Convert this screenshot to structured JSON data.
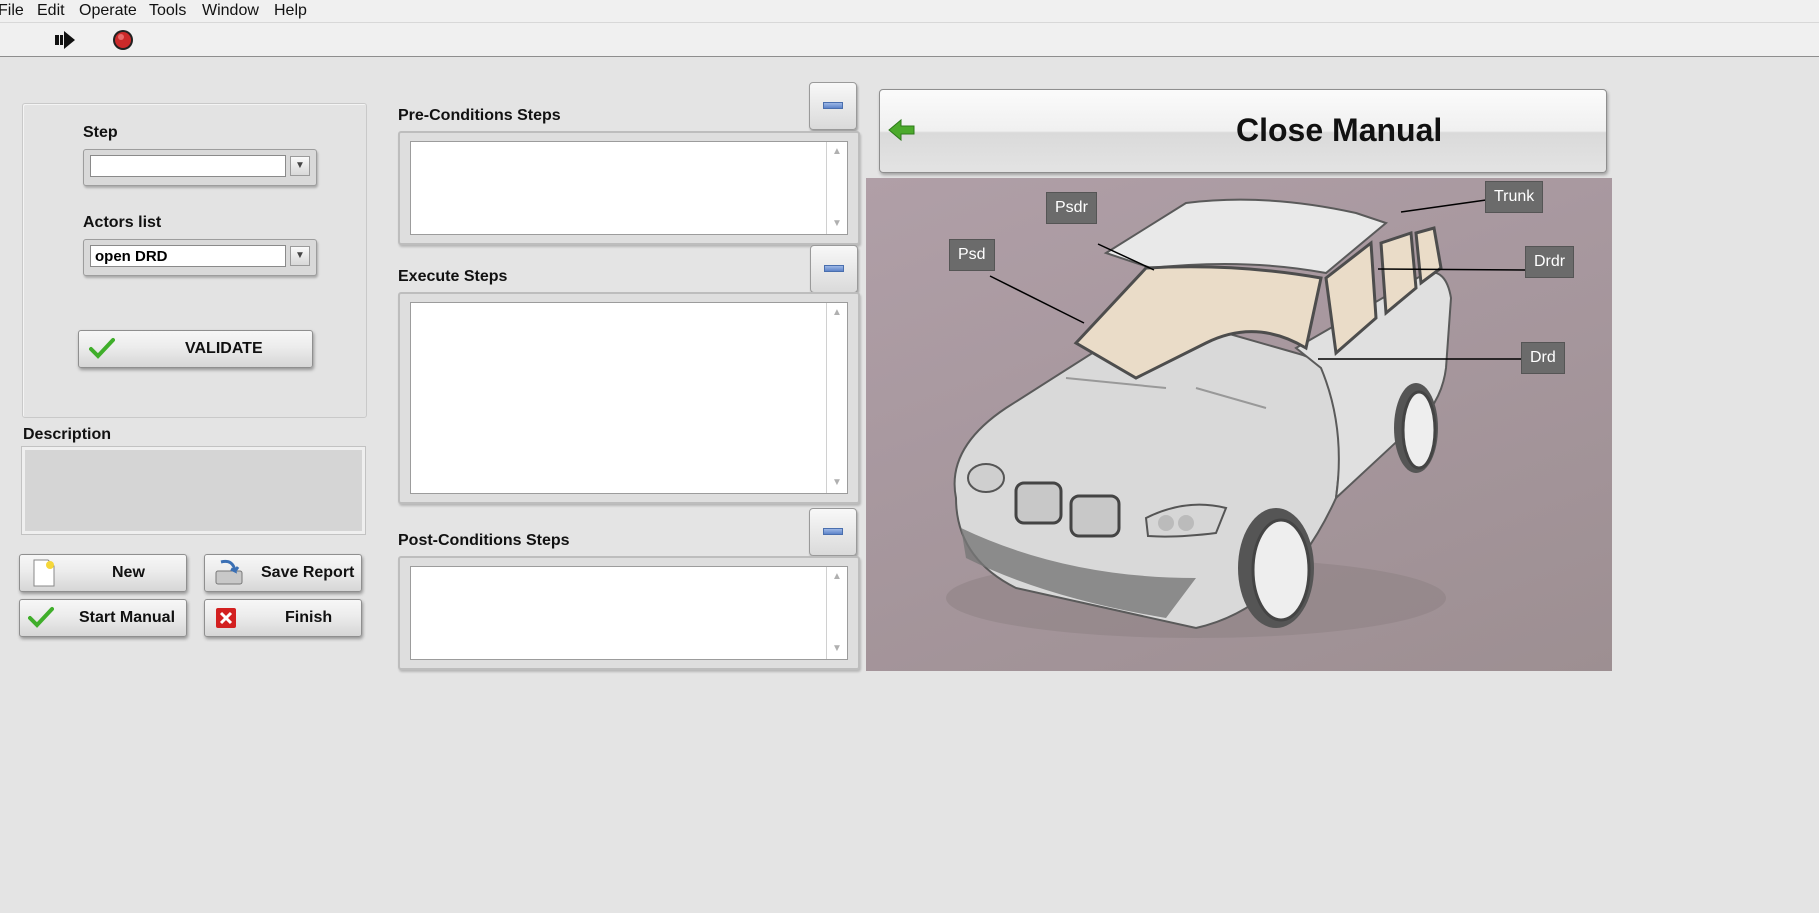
{
  "menu": {
    "items": [
      "File",
      "Edit",
      "Operate",
      "Tools",
      "Window",
      "Help"
    ]
  },
  "toolbar": {
    "run_icon": "run-arrow-icon",
    "stop_icon": "stop-icon"
  },
  "form": {
    "step_label": "Step",
    "step_value": "",
    "actors_label": "Actors list",
    "actors_value": "open DRD",
    "validate_label": "VALIDATE",
    "description_label": "Description",
    "description_value": ""
  },
  "buttons": {
    "new_label": "New",
    "save_report_label": "Save Report",
    "start_manual_label": "Start Manual",
    "finish_label": "Finish"
  },
  "steps": {
    "pre_label": "Pre-Conditions Steps",
    "pre_value": "",
    "execute_label": "Execute Steps",
    "execute_value": "",
    "post_label": "Post-Conditions Steps",
    "post_value": ""
  },
  "close_manual": {
    "label": "Close Manual"
  },
  "car": {
    "callouts": {
      "psdr": "Psdr",
      "psd": "Psd",
      "trunk": "Trunk",
      "drdr": "Drdr",
      "drd": "Drd"
    }
  },
  "colors": {
    "background": "#e4e4e4",
    "car_backdrop": "#a8989f",
    "callout_bg": "#6b6b6b",
    "finish_icon": "#d32020",
    "check_icon": "#3fae2a",
    "back_arrow": "#4caa2c"
  }
}
